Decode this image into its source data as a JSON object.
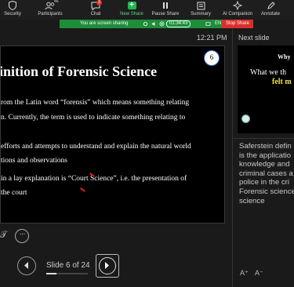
{
  "toolbar": {
    "items": [
      {
        "label": "Security",
        "icon": "shield-icon"
      },
      {
        "label": "Participants",
        "icon": "participants-icon",
        "count": "46"
      },
      {
        "label": "Chat",
        "icon": "chat-icon",
        "badge": "3"
      },
      {
        "label": "New Share",
        "icon": "share-arrow-icon"
      },
      {
        "label": "Pause Share",
        "icon": "pause-icon"
      },
      {
        "label": "Summary",
        "icon": "summary-icon"
      },
      {
        "label": "AI Companion",
        "icon": "ai-companion-icon"
      },
      {
        "label": "Annotate",
        "icon": "annotate-icon"
      }
    ]
  },
  "share_bar": {
    "text": "You are screen sharing",
    "timer": "01:34:43",
    "language": "EN",
    "stop_label": "Stop Share",
    "color": "#1f8d3a",
    "stop_color": "#d9302c"
  },
  "presenter": {
    "clock": "12:21 PM",
    "slide_number": "6",
    "slide_title": "inition of Forensic Science",
    "slide_lines": [
      "rom the Latin word “forensis” which means something relating",
      "n. Currently, the term is used to indicate something relating to",
      "efforts and attempts to understand and explain the natural world",
      "tions and observations",
      "in a lay explanation is “Court Science”, i.e. the presentation of",
      " the court"
    ],
    "counter": "Slide 6 of 24",
    "progress": 0.25
  },
  "next_slide": {
    "label": "Next slide",
    "lines": [
      "Why",
      "What we th",
      "felt m"
    ]
  },
  "notes": {
    "lines": [
      "Saferstein defin",
      "is the applicatio",
      "knowledge and",
      "criminal cases a",
      "police in the cri",
      "Forensic science",
      "science"
    ],
    "font_increase": "A⁺",
    "font_decrease": "A⁻"
  }
}
